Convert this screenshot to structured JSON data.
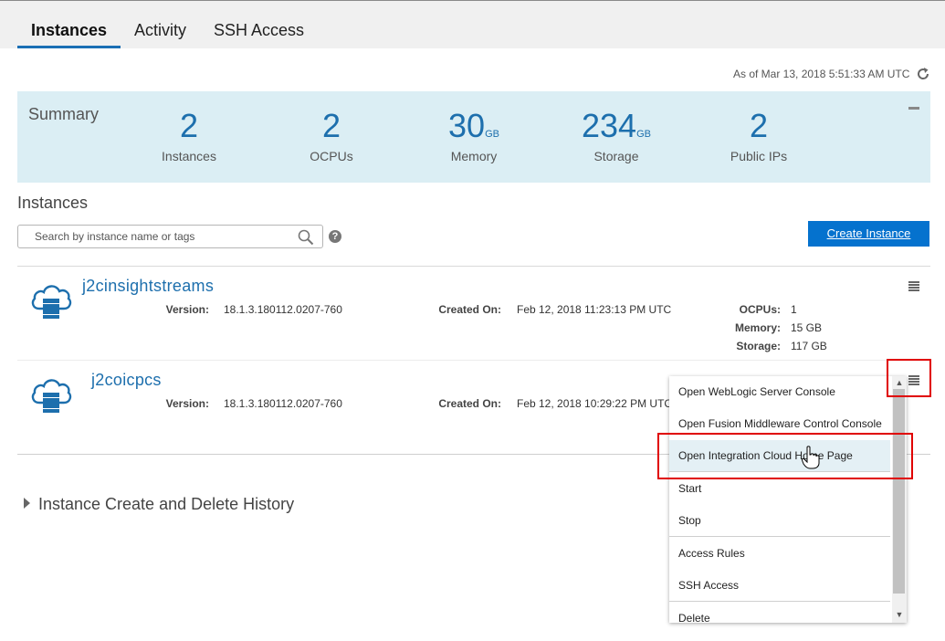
{
  "tabs": [
    {
      "label": "Instances",
      "active": true
    },
    {
      "label": "Activity",
      "active": false
    },
    {
      "label": "SSH Access",
      "active": false
    }
  ],
  "as_of": "As of Mar 13, 2018 5:51:33 AM UTC",
  "summary": {
    "title": "Summary",
    "metrics": [
      {
        "value": "2",
        "unit": "",
        "label": "Instances"
      },
      {
        "value": "2",
        "unit": "",
        "label": "OCPUs"
      },
      {
        "value": "30",
        "unit": "GB",
        "label": "Memory"
      },
      {
        "value": "234",
        "unit": "GB",
        "label": "Storage"
      },
      {
        "value": "2",
        "unit": "",
        "label": "Public IPs"
      }
    ]
  },
  "instances_section": {
    "heading": "Instances",
    "search_placeholder": "Search by instance name or tags",
    "help": "?",
    "create_button": "Create Instance"
  },
  "instances": [
    {
      "name": "j2cinsightstreams",
      "version_label": "Version:",
      "version": "18.1.3.180112.0207-760",
      "created_label": "Created On:",
      "created": "Feb 12, 2018 11:23:13 PM UTC",
      "ocpus_label": "OCPUs:",
      "ocpus": "1",
      "memory_label": "Memory:",
      "memory": "15 GB",
      "storage_label": "Storage:",
      "storage": "117 GB"
    },
    {
      "name": "j2coicpcs",
      "version_label": "Version:",
      "version": "18.1.3.180112.0207-760",
      "created_label": "Created On:",
      "created": "Feb 12, 2018 10:29:22 PM UTC"
    }
  ],
  "menu": {
    "items": [
      "Open WebLogic Server Console",
      "Open Fusion Middleware Control Console",
      "Open Integration Cloud Home Page",
      "Start",
      "Stop",
      "Access Rules",
      "SSH Access",
      "Delete"
    ],
    "highlighted": "Open Integration Cloud Home Page"
  },
  "history": "Instance Create and Delete History",
  "colors": {
    "accent": "#1d6fad",
    "button": "#0572ce",
    "summary_bg": "#dbeef4",
    "highlight_box": "#e00000"
  },
  "icons": [
    "refresh-icon",
    "collapse-icon",
    "search-icon",
    "help-icon",
    "cloud-database-icon",
    "hamburger-menu-icon",
    "expand-triangle-icon",
    "hand-cursor-icon"
  ]
}
